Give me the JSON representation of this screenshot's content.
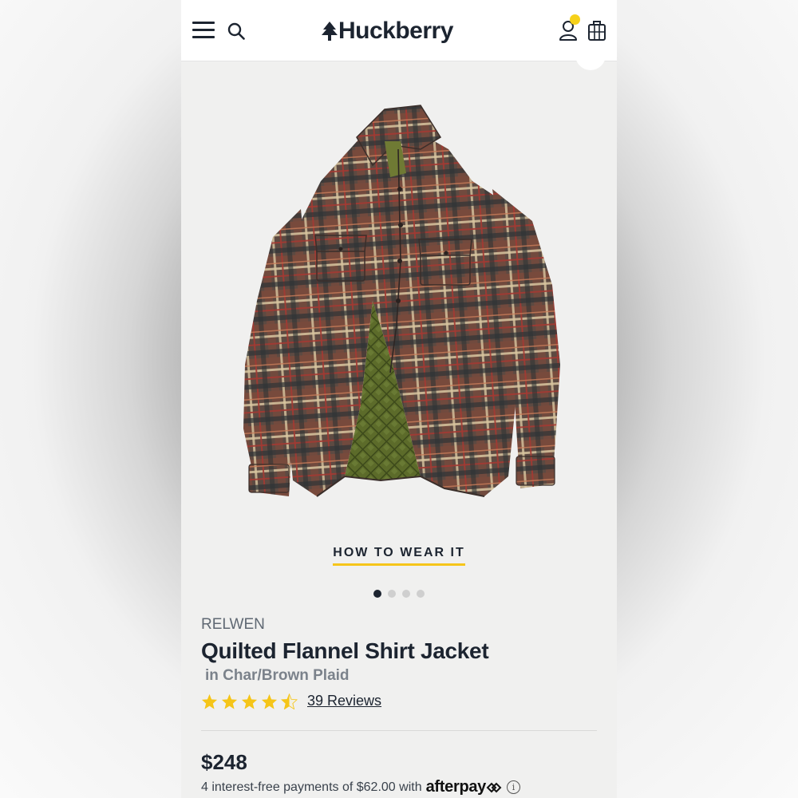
{
  "header": {
    "logo_text": "Huckberry",
    "menu_icon": "hamburger-menu-icon",
    "search_icon": "search-icon",
    "account_icon": "account-icon",
    "bag_icon": "shopping-bag-icon",
    "notification_color": "#f6d11a"
  },
  "gallery": {
    "image_subject": "plaid quilted flannel shirt jacket",
    "how_to_label": "HOW TO WEAR IT",
    "dots_total": 4,
    "dots_active_index": 0
  },
  "product": {
    "brand": "RELWEN",
    "title": "Quilted Flannel Shirt Jacket",
    "variant": "in Char/Brown Plaid",
    "rating": 4.5,
    "rating_max": 5,
    "reviews_label": "39 Reviews",
    "price": "$248",
    "installments_text": "4 interest-free payments of $62.00 with",
    "afterpay_label": "afterpay",
    "info_icon": "info-icon"
  },
  "colors": {
    "brand_navy": "#1c2430",
    "accent_yellow": "#f6c51a",
    "star_yellow": "#f5c518"
  }
}
